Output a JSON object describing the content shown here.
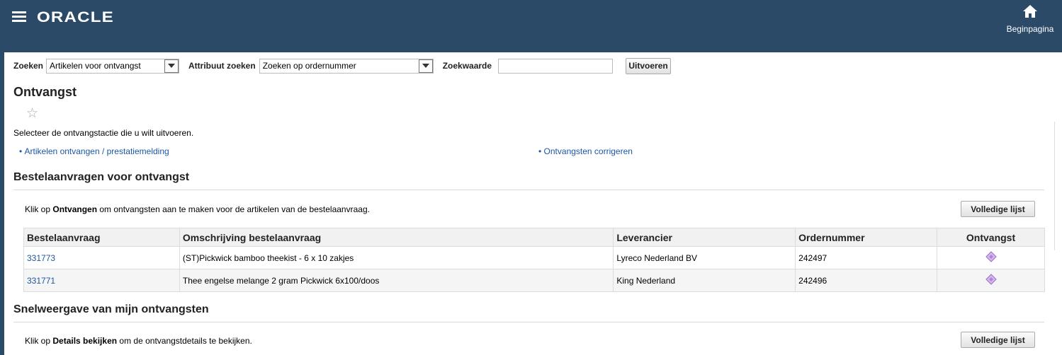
{
  "header": {
    "logo": "ORACLE",
    "home_label": "Beginpagina"
  },
  "search": {
    "label": "Zoeken",
    "selected": "Artikelen voor ontvangst",
    "attr_label": "Attribuut zoeken",
    "attr_selected": "Zoeken op ordernummer",
    "value_label": "Zoekwaarde",
    "value": "",
    "go_button": "Uitvoeren"
  },
  "page": {
    "title": "Ontvangst",
    "instruction": "Selecteer de ontvangstactie die u wilt uitvoeren.",
    "links": [
      "Artikelen ontvangen / prestatiemelding",
      "Ontvangsten corrigeren"
    ]
  },
  "requisitions": {
    "title": "Bestelaanvragen voor ontvangst",
    "hint_pre": "Klik op ",
    "hint_bold": "Ontvangen",
    "hint_post": " om ontvangsten aan te maken voor de artikelen van de bestelaanvraag.",
    "full_list_button": "Volledige lijst",
    "columns": [
      "Bestelaanvraag",
      "Omschrijving bestelaanvraag",
      "Leverancier",
      "Ordernummer",
      "Ontvangst"
    ],
    "rows": [
      {
        "req": "331773",
        "desc": "(ST)Pickwick bamboo theekist - 6 x 10 zakjes",
        "supplier": "Lyreco Nederland BV",
        "order": "242497"
      },
      {
        "req": "331771",
        "desc": "Thee engelse melange 2 gram Pickwick 6x100/doos",
        "supplier": "King Nederland",
        "order": "242496"
      }
    ]
  },
  "receipts": {
    "title": "Snelweergave van mijn ontvangsten",
    "hint_pre": "Klik op ",
    "hint_bold": "Details bekijken",
    "hint_post": " om de ontvangstdetails te bekijken.",
    "full_list_button": "Volledige lijst"
  }
}
